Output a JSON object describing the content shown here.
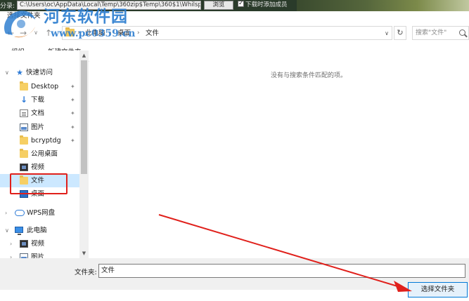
{
  "background_app": {
    "path_label": "分录:",
    "path_value": "C:\\Users\\oc\\AppData\\Local\\Temp\\360zip$Temp\\360$1\\Whilsp",
    "button_label": "浏览",
    "checkbox_label": "下载时添加成员"
  },
  "dialog": {
    "title": "选择文件夹",
    "address": {
      "crumbs": [
        "此电脑",
        "桌面",
        "文件"
      ],
      "search_placeholder": "搜索\"文件\""
    },
    "toolbar": {
      "organize_label": "组织",
      "new_folder_label": "新建文件夹"
    },
    "nav": {
      "quick_access": "快速访问",
      "items": [
        {
          "label": "Desktop",
          "icon": "folder-icon",
          "pinned": true
        },
        {
          "label": "下载",
          "icon": "download-icon",
          "pinned": true
        },
        {
          "label": "文档",
          "icon": "document-icon",
          "pinned": true
        },
        {
          "label": "图片",
          "icon": "picture-icon",
          "pinned": true
        },
        {
          "label": "bcryptdg",
          "icon": "folder-icon",
          "pinned": true
        },
        {
          "label": "公用桌面",
          "icon": "folder-icon",
          "pinned": false
        },
        {
          "label": "视频",
          "icon": "video-icon",
          "pinned": false
        },
        {
          "label": "文件",
          "icon": "folder-icon",
          "pinned": false,
          "selected": true
        },
        {
          "label": "桌面",
          "icon": "desktop-icon",
          "pinned": false
        }
      ],
      "wps": "WPS网盘",
      "this_pc": "此电脑",
      "pc_items": [
        {
          "label": "视频",
          "icon": "video-icon"
        },
        {
          "label": "图片",
          "icon": "picture-icon"
        }
      ]
    },
    "content": {
      "empty_message": "没有与搜索条件匹配的项。"
    },
    "bottom": {
      "folder_label": "文件夹:",
      "folder_value": "文件",
      "select_button": "选择文件夹"
    }
  },
  "watermark": {
    "title": "河东软件园",
    "url": "www.pc0359.cn"
  },
  "colors": {
    "selection": "#cce8ff",
    "highlight_box": "#e0201b",
    "arrow": "#e0201b",
    "button_border": "#0078d7",
    "watermark": "#2f7fd0"
  }
}
